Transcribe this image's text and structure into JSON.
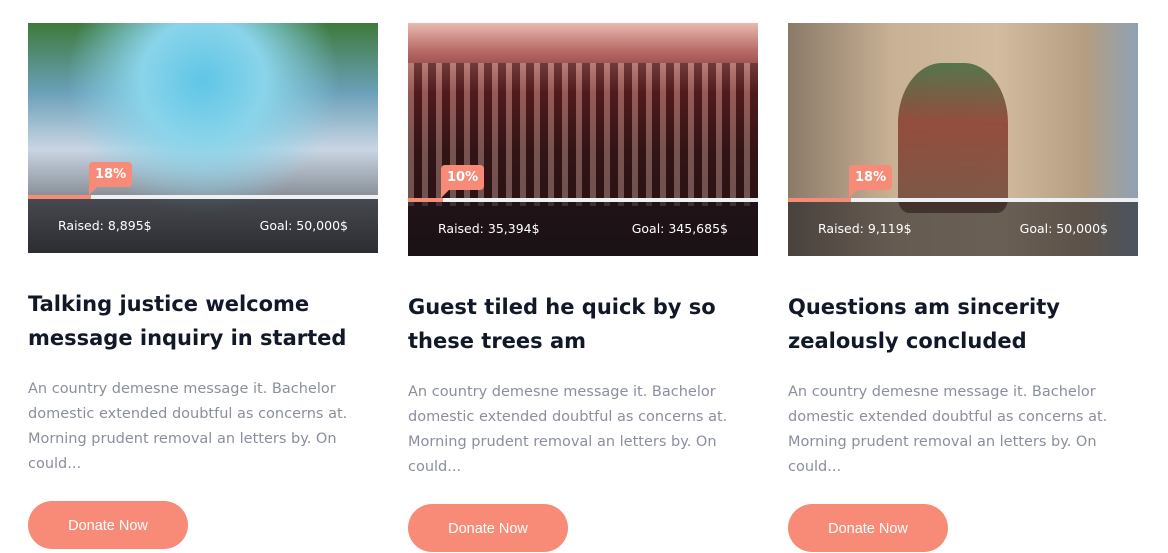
{
  "cards": [
    {
      "title": "Talking justice welcome message inquiry in started",
      "excerpt": "An country demesne message it. Bachelor domestic extended doubtful as concerns at. Morning prudent removal an letters by. On could...",
      "percent_label": "18%",
      "progress": 18,
      "raised": "Raised: 8,895$",
      "goal": "Goal: 50,000$",
      "button": "Donate Now"
    },
    {
      "title": "Guest tiled he quick by so these trees am",
      "excerpt": "An country demesne message it. Bachelor domestic extended doubtful as concerns at. Morning prudent removal an letters by. On could...",
      "percent_label": "10%",
      "progress": 10,
      "raised": "Raised: 35,394$",
      "goal": "Goal: 345,685$",
      "button": "Donate Now"
    },
    {
      "title": "Questions am sincerity zealously concluded",
      "excerpt": "An country demesne message it. Bachelor domestic extended doubtful as concerns at. Morning prudent removal an letters by. On could...",
      "percent_label": "18%",
      "progress": 18,
      "raised": "Raised: 9,119$",
      "goal": "Goal: 50,000$",
      "button": "Donate Now"
    }
  ],
  "colors": {
    "accent": "#f78b77",
    "title": "#111827",
    "text": "#8a8f9c"
  }
}
